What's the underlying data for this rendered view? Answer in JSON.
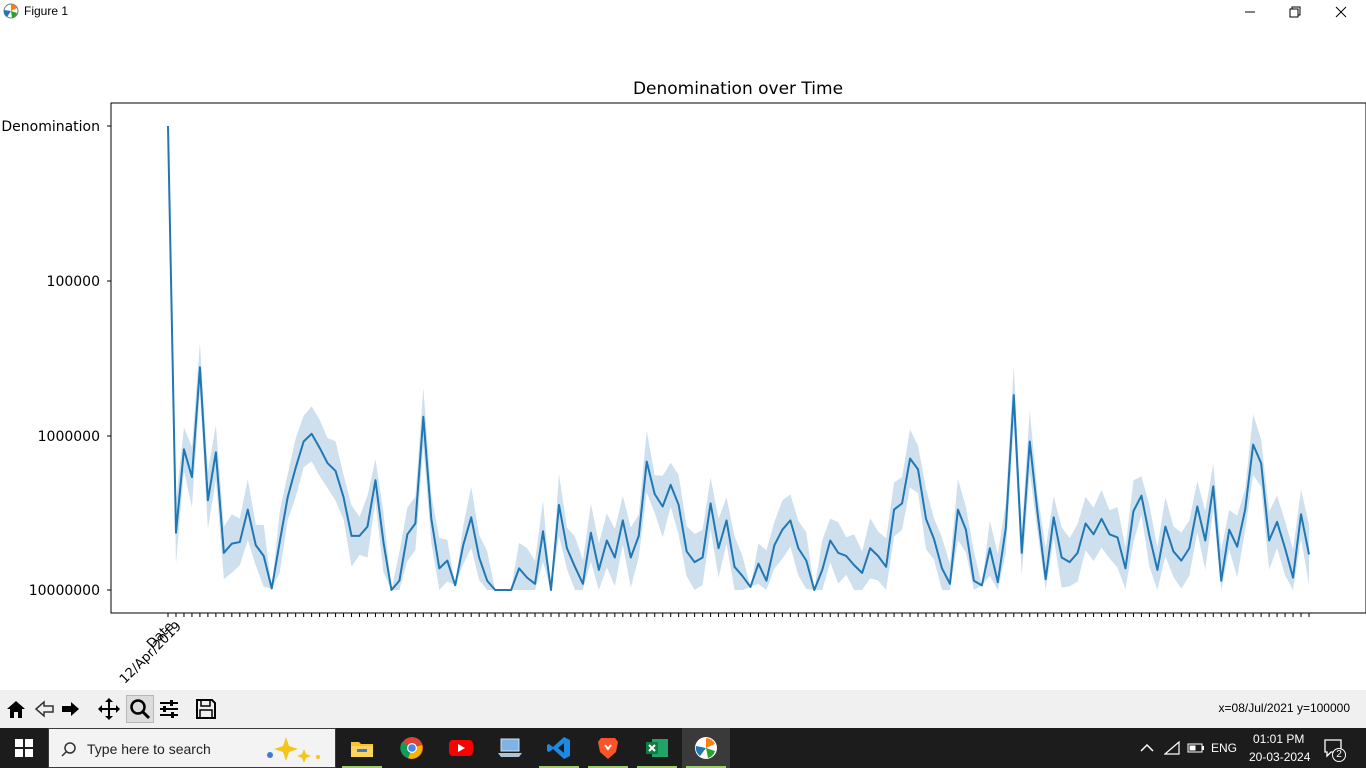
{
  "window": {
    "title": "Figure 1"
  },
  "toolbar": {
    "tools": [
      "home-icon",
      "back-icon",
      "forward-icon",
      "pan-icon",
      "zoom-icon",
      "configure-icon",
      "save-icon"
    ],
    "status": "x=08/Jul/2021 y=100000"
  },
  "taskbar": {
    "search_placeholder": "Type here to search",
    "apps": [
      "file-explorer-icon",
      "chrome-icon",
      "youtube-icon",
      "laptop-icon",
      "vscode-icon",
      "brave-icon",
      "excel-icon",
      "matplotlib-icon"
    ],
    "language": "ENG",
    "time": "01:01 PM",
    "date": "20-03-2024",
    "notifications": "2"
  },
  "chart_data": {
    "type": "line",
    "title": "Denomination over Time",
    "xlabel": "",
    "ylabel": "",
    "y_categories": [
      "Denomination",
      "100000",
      "1000000",
      "10000000"
    ],
    "x_first_label": "Date",
    "x_second_label": "12/Apr/2019",
    "x_count": 144,
    "series_color": "#1f77b4",
    "band_color": "#aecbe3",
    "series": [
      {
        "values": [
          0.0,
          2.63,
          2.09,
          2.27,
          1.56,
          2.42,
          2.11,
          2.76,
          2.7,
          2.69,
          2.48,
          2.71,
          2.78,
          2.99,
          2.69,
          2.4,
          2.21,
          2.04,
          1.99,
          2.08,
          2.18,
          2.23,
          2.4,
          2.65,
          2.65,
          2.59,
          2.29,
          2.69,
          3.0,
          2.94,
          2.64,
          2.57,
          1.88,
          2.54,
          2.86,
          2.81,
          2.97,
          2.71,
          2.53,
          2.79,
          2.94,
          3.0,
          3.0,
          3.0,
          2.86,
          2.92,
          2.96,
          2.62,
          3.0,
          2.45,
          2.73,
          2.85,
          2.96,
          2.63,
          2.87,
          2.68,
          2.79,
          2.55,
          2.79,
          2.65,
          2.17,
          2.38,
          2.46,
          2.32,
          2.45,
          2.75,
          2.82,
          2.79,
          2.44,
          2.73,
          2.55,
          2.85,
          2.91,
          2.98,
          2.83,
          2.94,
          2.71,
          2.61,
          2.55,
          2.73,
          2.81,
          3.0,
          2.87,
          2.68,
          2.76,
          2.78,
          2.84,
          2.89,
          2.73,
          2.78,
          2.85,
          2.48,
          2.44,
          2.15,
          2.22,
          2.54,
          2.67,
          2.86,
          2.96,
          2.48,
          2.61,
          2.94,
          2.97,
          2.73,
          2.95,
          2.6,
          1.74,
          2.76,
          2.04,
          2.51,
          2.93,
          2.53,
          2.79,
          2.82,
          2.76,
          2.57,
          2.64,
          2.54,
          2.64,
          2.66,
          2.86,
          2.49,
          2.39,
          2.65,
          2.87,
          2.59,
          2.75,
          2.81,
          2.73,
          2.46,
          2.68,
          2.33,
          2.94,
          2.61,
          2.72,
          2.48,
          2.06,
          2.18,
          2.68,
          2.56,
          2.73,
          2.92,
          2.51,
          2.77
        ]
      }
    ],
    "ylim": [
      3.2,
      -0.15
    ],
    "grid": false
  }
}
